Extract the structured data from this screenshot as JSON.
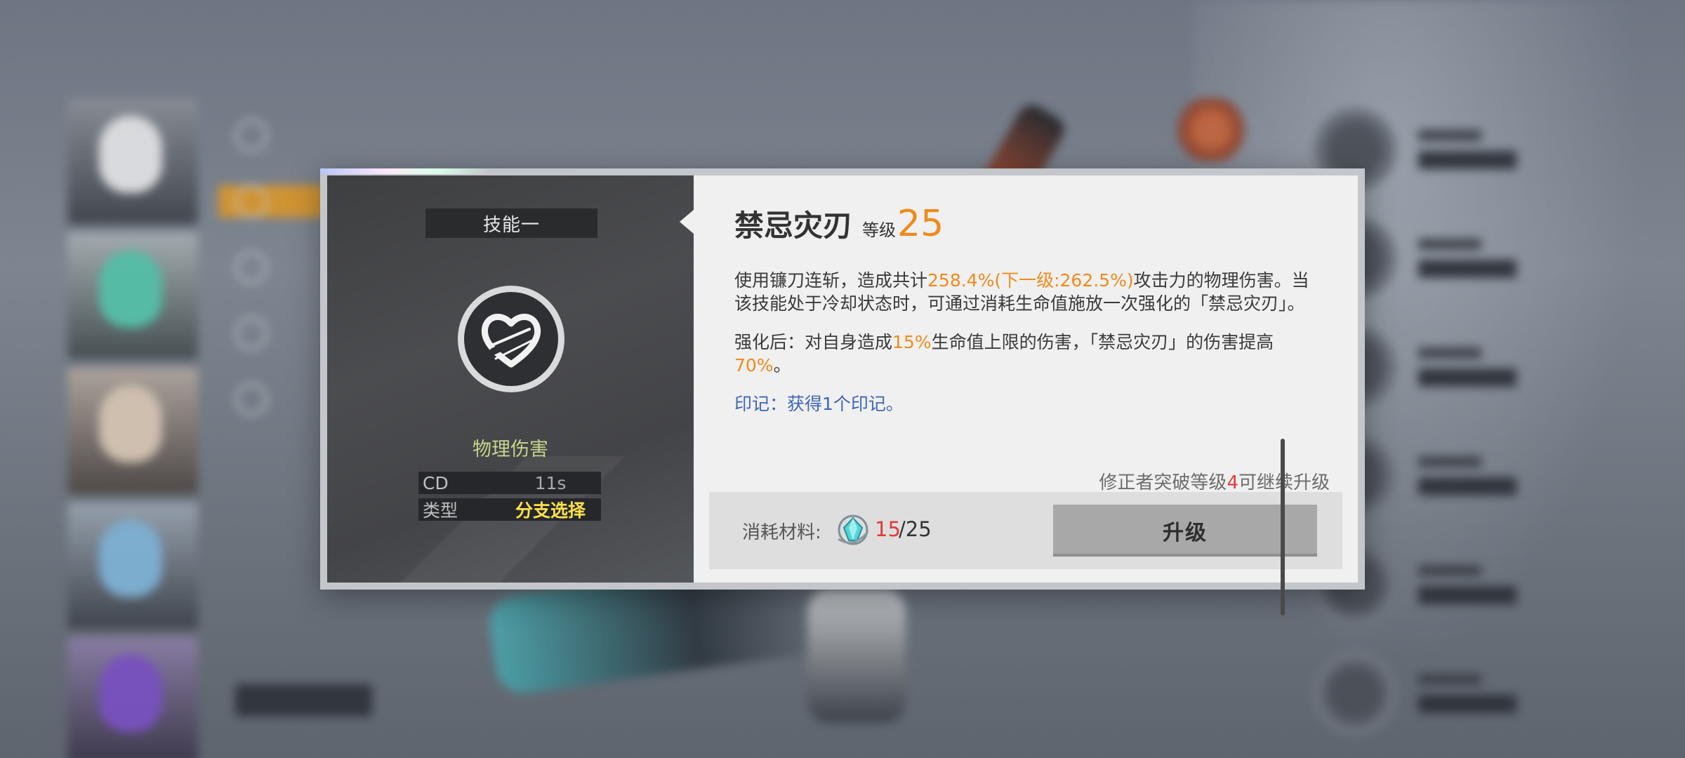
{
  "skill_panel": {
    "tab_label": "技能一",
    "damage_type": "物理伤害",
    "stats": [
      {
        "key": "CD",
        "value": "11s"
      },
      {
        "key": "类型",
        "value": "分支选择"
      }
    ]
  },
  "skill_detail": {
    "name": "禁忌灾刃",
    "level_label": "等级",
    "level": "25",
    "desc1_a": "使用镰刀连斩，造成共计",
    "desc1_pct": "258.4%(下一级:262.5%)",
    "desc1_b": "攻击力的物理伤害。当该技能处于冷却状态时，可通过消耗生命值施放一次强化的「禁忌灾刃」。",
    "desc2_a": "强化后：对自身造成",
    "desc2_pct1": "15%",
    "desc2_b": "生命值上限的伤害，「禁忌灾刃」的伤害提高",
    "desc2_pct2": "70%",
    "desc2_c": "。",
    "desc3": "印记：获得1个印记。",
    "requirement_a": "修正者突破等级",
    "requirement_num": "4",
    "requirement_b": "可继续升级"
  },
  "cost": {
    "label": "消耗材料:",
    "have": "15",
    "need": "/25"
  },
  "upgrade_button": "升级",
  "colors": {
    "accent_orange": "#f08a1c",
    "warning_red": "#e33a36",
    "type_yellow": "#ffe14a",
    "damage_green": "#c5d48a"
  }
}
